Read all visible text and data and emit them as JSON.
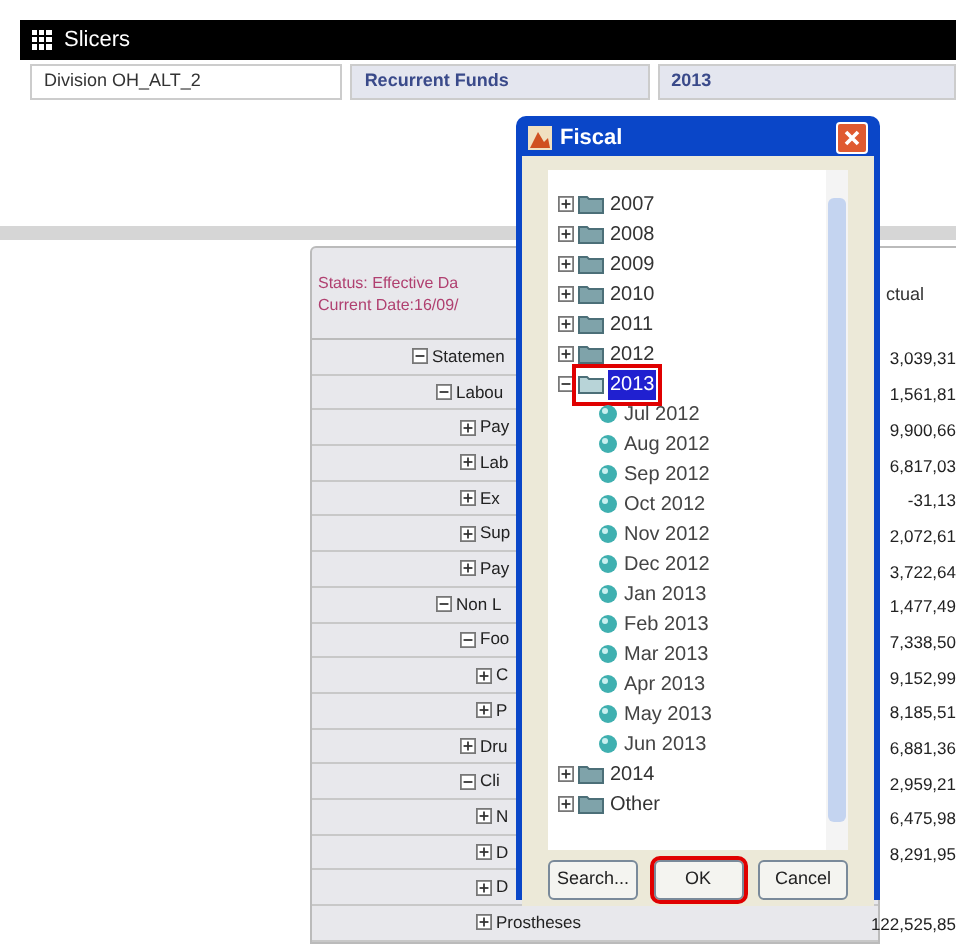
{
  "window": {
    "title": "Slicers"
  },
  "slicers": [
    {
      "label": "Division OH_ALT_2",
      "kind": "field"
    },
    {
      "label": "Recurrent Funds",
      "kind": "tab"
    },
    {
      "label": "2013",
      "kind": "tab"
    }
  ],
  "report": {
    "status_lines": [
      "Status:  Effective Da",
      "Current Date:16/09/"
    ],
    "column_header": "ctual",
    "rows": [
      {
        "label": "Statemen",
        "value": "3,039,31",
        "expanded": true,
        "children": [
          {
            "label": "Labou",
            "value": "1,561,81",
            "expanded": true,
            "children": [
              {
                "label": "Pay",
                "value": "9,900,66",
                "expanded": false
              },
              {
                "label": "Lab",
                "value": "6,817,03",
                "expanded": false
              },
              {
                "label": "Ex",
                "value": "-31,13",
                "expanded": false
              },
              {
                "label": "Sup",
                "value": "2,072,61",
                "expanded": false
              },
              {
                "label": "Pay",
                "value": "3,722,64",
                "expanded": false
              }
            ]
          },
          {
            "label": "Non L",
            "value": "1,477,49",
            "expanded": true,
            "children": [
              {
                "label": "Foo",
                "value": "7,338,50",
                "expanded": true,
                "children": [
                  {
                    "label": "C",
                    "value": "9,152,99",
                    "expanded": false
                  },
                  {
                    "label": "P",
                    "value": "8,185,51",
                    "expanded": false
                  }
                ]
              },
              {
                "label": "Dru",
                "value": "6,881,36",
                "expanded": false
              },
              {
                "label": "Cli",
                "value": "2,959,21",
                "expanded": true,
                "children": [
                  {
                    "label": "N",
                    "value": "6,475,98",
                    "expanded": false
                  },
                  {
                    "label": "D",
                    "value": "8,291,95",
                    "expanded": false
                  },
                  {
                    "label": "D",
                    "expanded": false
                  },
                  {
                    "label": "Prostheses",
                    "value": "122,525,85",
                    "expanded": false
                  }
                ]
              }
            ]
          }
        ]
      }
    ]
  },
  "dialog": {
    "title": "Fiscal",
    "tree": [
      {
        "label": "2007",
        "expanded": false,
        "selected": false,
        "highlighted": false
      },
      {
        "label": "2008",
        "expanded": false,
        "selected": false,
        "highlighted": false
      },
      {
        "label": "2009",
        "expanded": false,
        "selected": false,
        "highlighted": false
      },
      {
        "label": "2010",
        "expanded": false,
        "selected": false,
        "highlighted": false
      },
      {
        "label": "2011",
        "expanded": false,
        "selected": false,
        "highlighted": false
      },
      {
        "label": "2012",
        "expanded": false,
        "selected": false,
        "highlighted": false
      },
      {
        "label": "2013",
        "expanded": true,
        "selected": true,
        "highlighted": true,
        "children": [
          {
            "label": "Jul 2012",
            "selected": false
          },
          {
            "label": "Aug 2012",
            "selected": false
          },
          {
            "label": "Sep 2012",
            "selected": false
          },
          {
            "label": "Oct 2012",
            "selected": false
          },
          {
            "label": "Nov 2012",
            "selected": false
          },
          {
            "label": "Dec 2012",
            "selected": false
          },
          {
            "label": "Jan 2013",
            "selected": false
          },
          {
            "label": "Feb 2013",
            "selected": false
          },
          {
            "label": "Mar 2013",
            "selected": false
          },
          {
            "label": "Apr 2013",
            "selected": false
          },
          {
            "label": "May 2013",
            "selected": false
          },
          {
            "label": "Jun 2013",
            "selected": false
          }
        ]
      },
      {
        "label": "2014",
        "expanded": false,
        "selected": false,
        "highlighted": false
      },
      {
        "label": "Other",
        "expanded": false,
        "selected": false,
        "highlighted": false
      }
    ],
    "buttons": [
      {
        "label": "Search...",
        "highlighted": false
      },
      {
        "label": "OK",
        "highlighted": true
      },
      {
        "label": "Cancel",
        "highlighted": false
      }
    ]
  }
}
